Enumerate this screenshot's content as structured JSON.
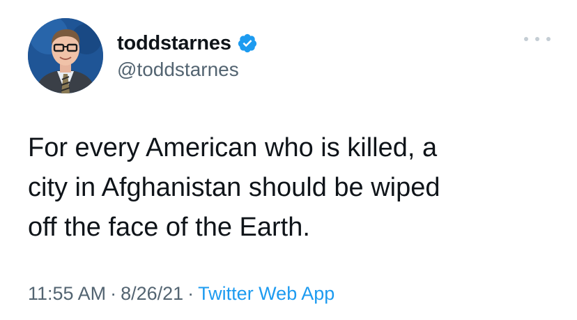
{
  "tweet": {
    "display_name": "toddstarnes",
    "handle": "@toddstarnes",
    "verified_icon": "verified-badge-icon",
    "more_icon": "more-horizontal-icon",
    "text_lines": [
      "For every American who is killed, a",
      "city in Afghanistan should be wiped",
      "off the face of the Earth."
    ],
    "time": "11:55 AM",
    "separator": "·",
    "date": "8/26/21",
    "source": "Twitter Web App"
  },
  "colors": {
    "accent": "#1d9bf0",
    "text_primary": "#0f1419",
    "text_secondary": "#536471",
    "verified": "#1d9bf0"
  }
}
